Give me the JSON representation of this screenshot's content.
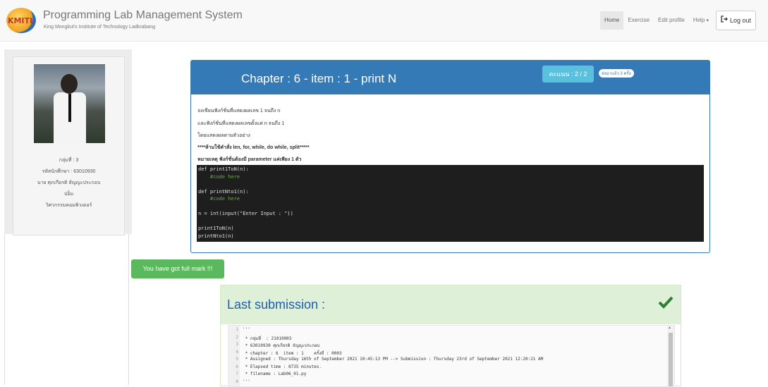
{
  "brand": {
    "logo_text": "KMITL",
    "title": "Programming Lab Management System",
    "subtitle": "King Mongkut's Institute of Technology Ladkrabang"
  },
  "nav": {
    "home": "Home",
    "exercise": "Exercise",
    "edit_profile": "Edit profile",
    "help": "Help",
    "logout": "Log out"
  },
  "profile": {
    "group": "กลุ่มที่ : 3",
    "student_id": "รหัสนักศึกษา : 63010930",
    "name": "นาย ศุภเกียรติ ธัญญะประกอบ",
    "nickname": "ปอ็ม",
    "department": "วิศวกรรมคอมพิวเตอร์"
  },
  "problem": {
    "title": "Chapter : 6 - item : 1 - print N",
    "score": "คะแนน : 2 / 2",
    "sent_badge": "ส่งมาแล้ว 3 ครั้ง",
    "lines": [
      "จงเขียนฟังก์ชั่นที่แสดงผลเลข 1 จนถึง n",
      "และฟังก์ชั่นที่แสดงผลเลขตั้งแต่ n จนถึง 1",
      "โดยแสดงผลตามตัวอย่าง",
      "****ห้ามใช้คำสั่ง len, for, while, do while, split*****",
      "หมายเหตุ ฟังก์ชั่นต้องมี parameter แค่เพียง 1 ตัว"
    ],
    "code": [
      {
        "text": "def print1ToN(n):",
        "color": "#e0e0e0"
      },
      {
        "text": "    #code here",
        "color": "#6aa84f"
      },
      {
        "text": "",
        "color": "#e0e0e0"
      },
      {
        "text": "def printNto1(n):",
        "color": "#e0e0e0"
      },
      {
        "text": "    #code here",
        "color": "#6aa84f"
      },
      {
        "text": "",
        "color": "#e0e0e0"
      },
      {
        "text": "n = int(input(\"Enter Input : \"))",
        "color": "#e0e0e0"
      },
      {
        "text": "",
        "color": "#e0e0e0"
      },
      {
        "text": "print1ToN(n)",
        "color": "#e0e0e0"
      },
      {
        "text": "printNto1(n)",
        "color": "#e0e0e0"
      }
    ]
  },
  "fullmark": "You have got full mark !!!",
  "last_submission": {
    "title": "Last submission :",
    "lines": [
      {
        "num": "1",
        "text": "'''"
      },
      {
        "num": "2",
        "text": " * กลุ่มที่  : 21010003"
      },
      {
        "num": "3",
        "text": " * 63010930 ศุภเกียรติ ธัญญะประกอบ"
      },
      {
        "num": "4",
        "text": " * chapter : 6  item : 1    ครั้งที่ : 0003"
      },
      {
        "num": "5",
        "text": " * Assigned : Thursday 16th of September 2021 10:45:13 PM --> Submission : Thursday 23rd of September 2021 12:20:21 AM"
      },
      {
        "num": "6",
        "text": " * Elapsed time : 8735 minutes."
      },
      {
        "num": "7",
        "text": " * filename : Lab06_01.py"
      },
      {
        "num": "8",
        "text": "'''"
      }
    ]
  },
  "colors": {
    "primary": "#337ab7",
    "success": "#5cb85c",
    "info": "#5bc0de",
    "success_bg": "#dff0d8"
  }
}
